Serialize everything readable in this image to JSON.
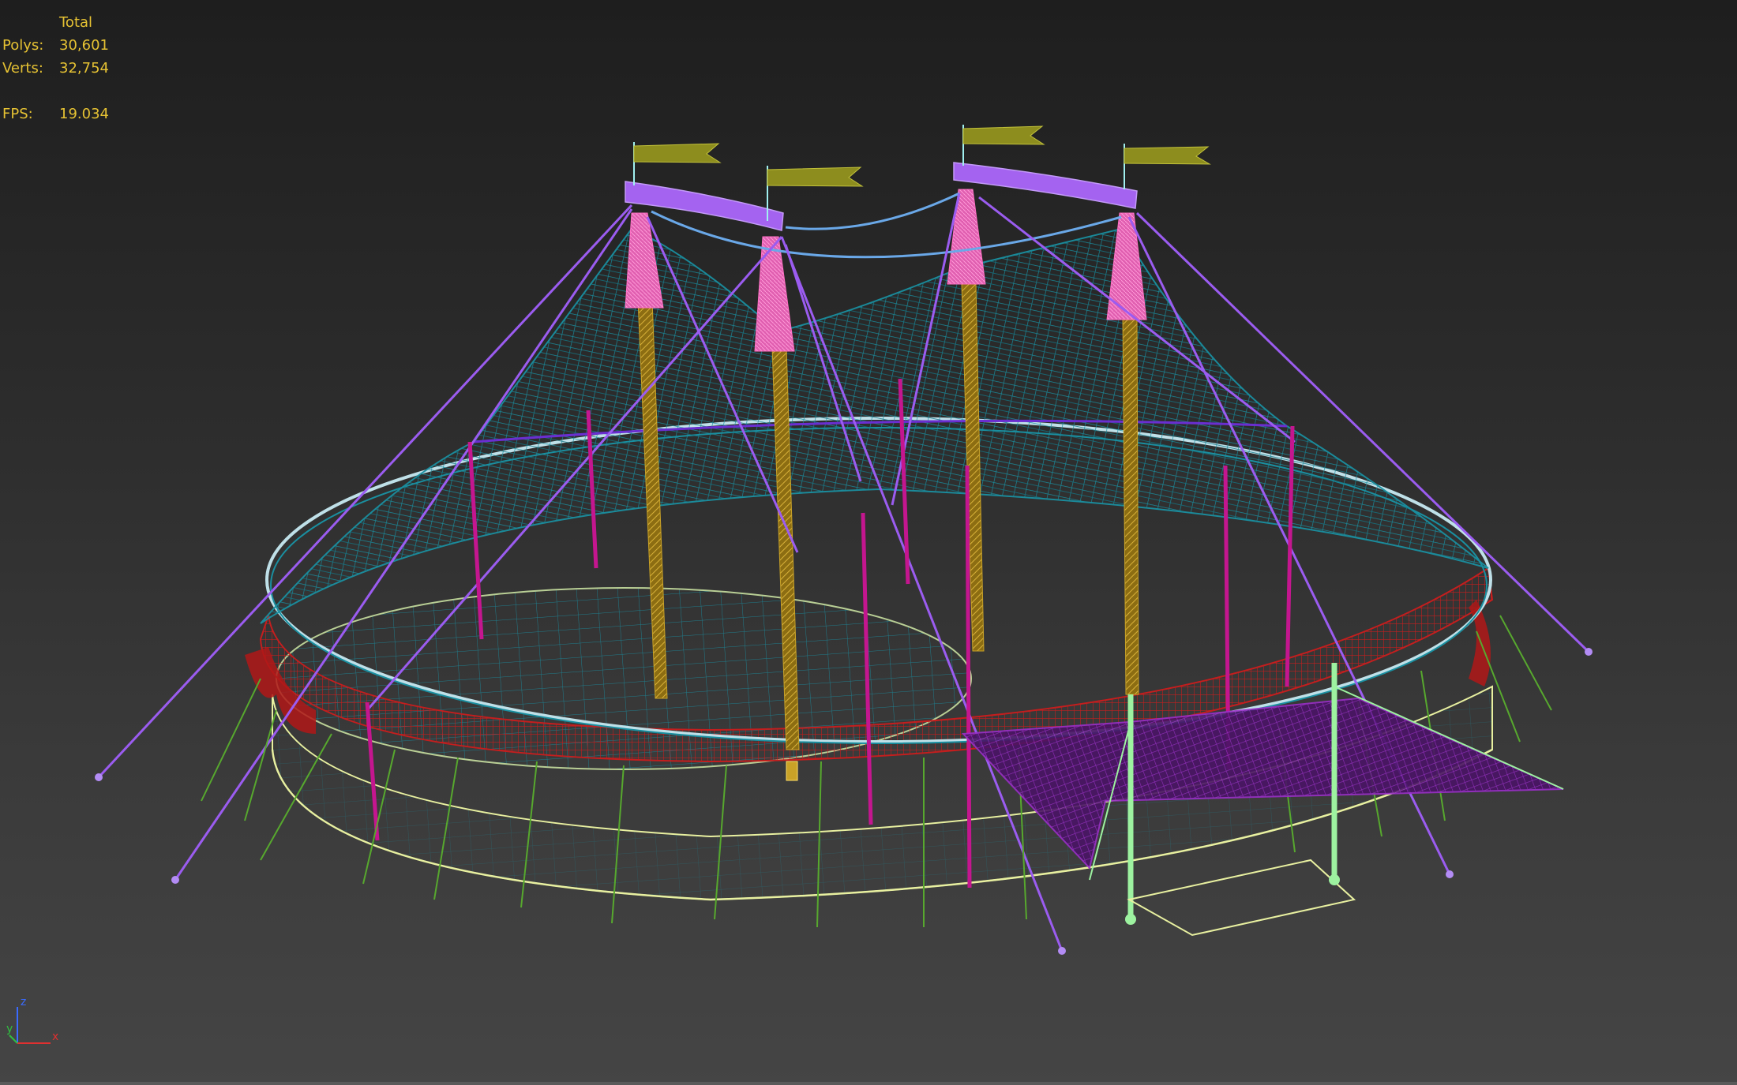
{
  "stats": {
    "header": "Total",
    "polys_label": "Polys:",
    "polys_value": "30,601",
    "verts_label": "Verts:",
    "verts_value": "32,754",
    "fps_label": "FPS:",
    "fps_value": "19.034"
  },
  "axis": {
    "z": "z",
    "y": "y",
    "x": "x"
  },
  "colors": {
    "stats_text": "#e6c233",
    "tent_top": "#1a8fa0",
    "valance": "#c41e1e",
    "masts": "#c9a227",
    "mast_caps": "#ff6fc4",
    "truss": "#a463f0",
    "guy_lines": "#9b5cf0",
    "flags": "#8d8d1e",
    "side_poles": "#c4168f",
    "stakes": "#57a82e",
    "entrance": "#8a24b0",
    "entrance_poles": "#9df2a0",
    "base_outline": "#e8f0a0"
  }
}
